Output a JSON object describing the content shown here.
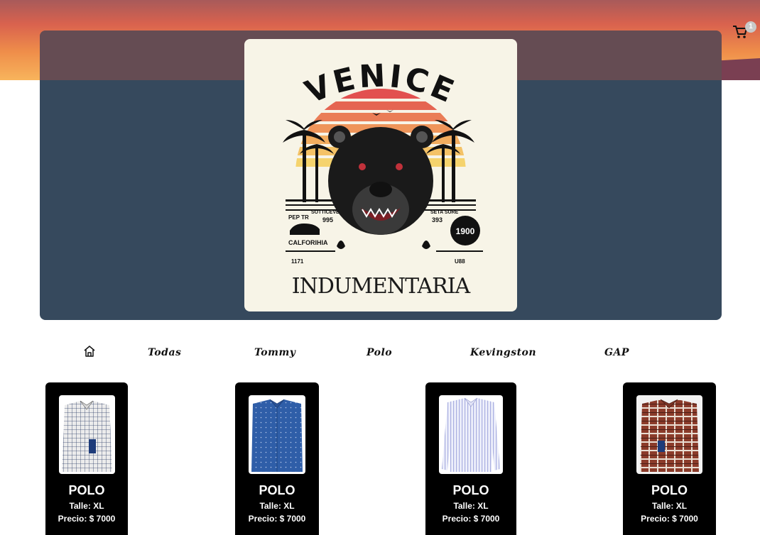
{
  "header": {
    "cart_count": "1",
    "cart_icon": "shopping-cart-icon"
  },
  "hero": {
    "logo": {
      "brand": "VENICE",
      "subtitle": "INDUMENTARIA",
      "left_text_1": "PEP TR",
      "left_text_2": "SOTTICEVE",
      "left_text_3": "995",
      "left_text_4": "CALFORIHIA",
      "left_text_5": "1171",
      "right_text_1": "SETA SURE",
      "right_text_2": "393",
      "right_text_3": "1900",
      "right_text_4": "U88"
    }
  },
  "nav": {
    "home_icon": "home-icon",
    "items": [
      {
        "label": "Todas"
      },
      {
        "label": "Tommy"
      },
      {
        "label": "Polo"
      },
      {
        "label": "Kevingston"
      },
      {
        "label": "GAP"
      }
    ]
  },
  "products": [
    {
      "title": "POLO",
      "size": "Talle: XL",
      "price": "Precio: $ 7000",
      "shirt_color": "#ececec",
      "pattern": "checkered-navy"
    },
    {
      "title": "POLO",
      "size": "Talle: XL",
      "price": "Precio: $ 7000",
      "shirt_color": "#2f5ea8",
      "pattern": "dotted-blue"
    },
    {
      "title": "POLO",
      "size": "Talle: XL",
      "price": "Precio: $ 7000",
      "shirt_color": "#d9dcf2",
      "pattern": "striped-lavender"
    },
    {
      "title": "POLO",
      "size": "Talle: XL",
      "price": "Precio: $ 7000",
      "shirt_color": "#8b3b2a",
      "pattern": "plaid-brown"
    }
  ]
}
